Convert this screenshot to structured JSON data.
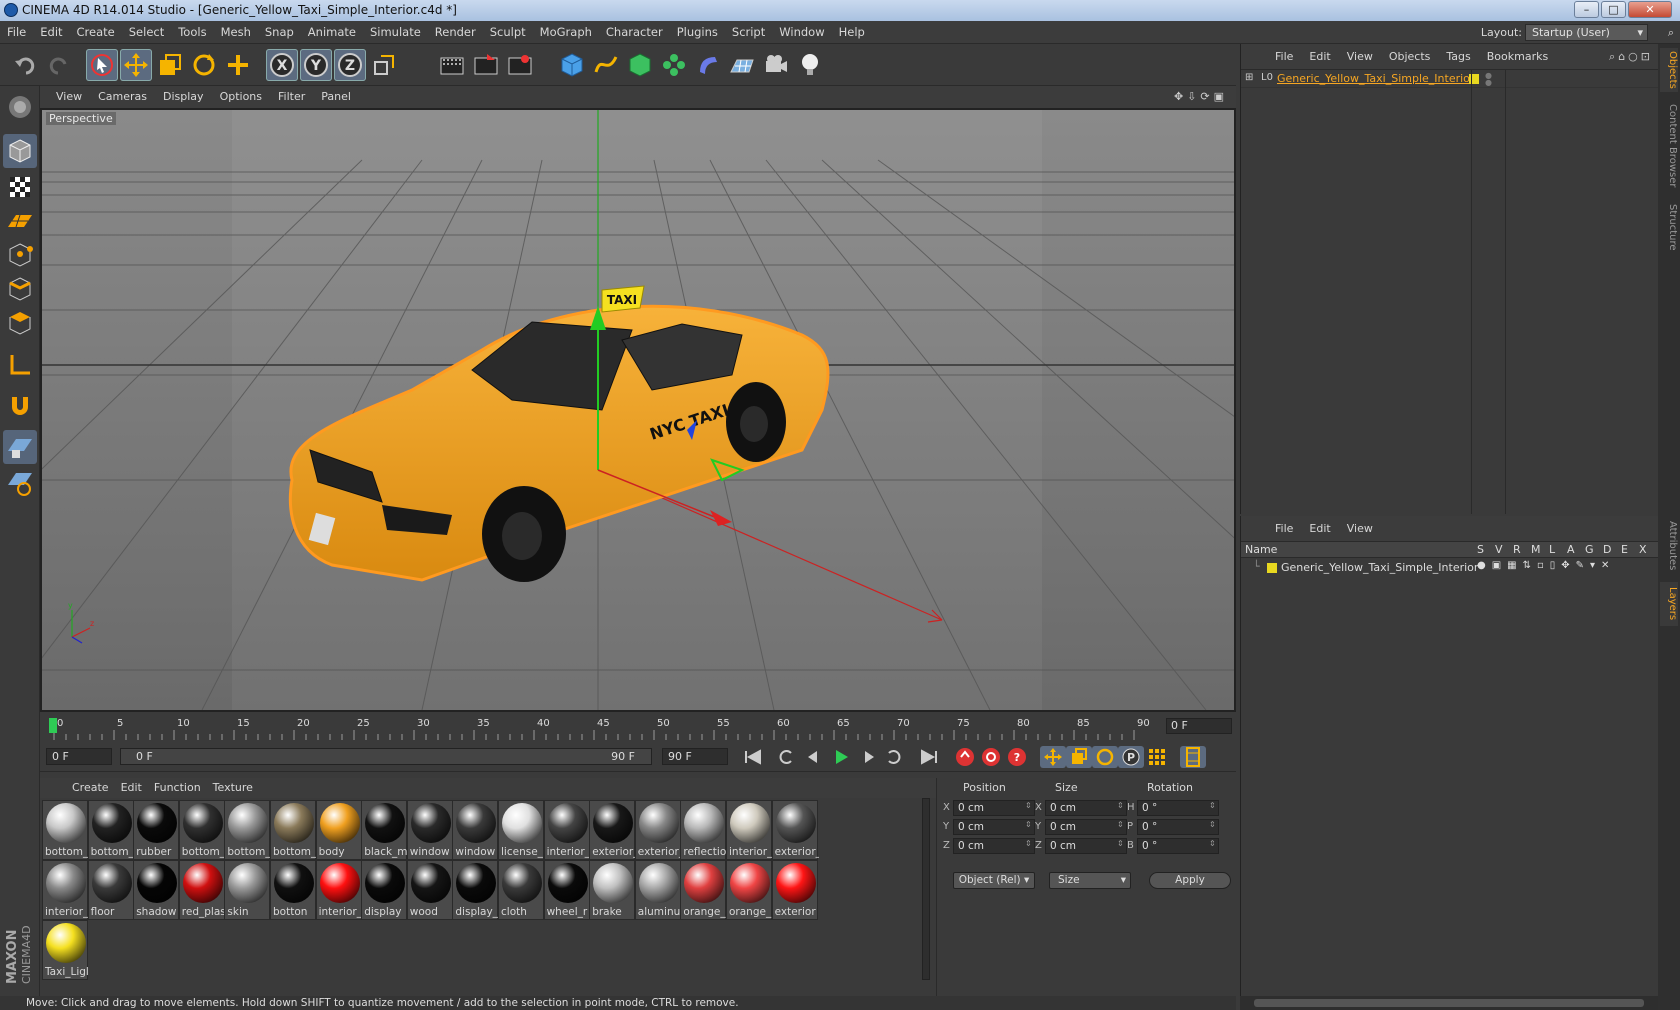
{
  "window": {
    "title": "CINEMA 4D R14.014 Studio - [Generic_Yellow_Taxi_Simple_Interior.c4d *]",
    "min": "–",
    "max": "□",
    "close": "✕"
  },
  "menu": [
    "File",
    "Edit",
    "Create",
    "Select",
    "Tools",
    "Mesh",
    "Snap",
    "Animate",
    "Simulate",
    "Render",
    "Sculpt",
    "MoGraph",
    "Character",
    "Plugins",
    "Script",
    "Window",
    "Help"
  ],
  "layout": {
    "label": "Layout:",
    "value": "Startup (User)"
  },
  "viewport": {
    "menu": [
      "View",
      "Cameras",
      "Display",
      "Options",
      "Filter",
      "Panel"
    ],
    "label": "Perspective",
    "taxi_sign": "TAXI",
    "door_text": "NYC TAXI"
  },
  "timeline": {
    "ticks": [
      "0",
      "5",
      "10",
      "15",
      "20",
      "25",
      "30",
      "35",
      "40",
      "45",
      "50",
      "55",
      "60",
      "65",
      "70",
      "75",
      "80",
      "85",
      "90"
    ],
    "current_frame": "0 F",
    "start": "0 F",
    "range_start": "0 F",
    "range_end": "90 F",
    "end": "90 F"
  },
  "materials": {
    "menu": [
      "Create",
      "Edit",
      "Function",
      "Texture"
    ],
    "items": [
      {
        "label": "bottom_",
        "color": "#c8c8c8"
      },
      {
        "label": "bottom_",
        "color": "#222222"
      },
      {
        "label": "rubber",
        "color": "#0a0a0a"
      },
      {
        "label": "bottom_",
        "color": "#303030"
      },
      {
        "label": "bottom_",
        "color": "#9a9a9a"
      },
      {
        "label": "bottom_",
        "color": "#8a7a5a"
      },
      {
        "label": "body",
        "color": "#f0a020"
      },
      {
        "label": "black_m",
        "color": "#111111"
      },
      {
        "label": "window",
        "color": "#2a2a2a"
      },
      {
        "label": "window",
        "color": "#3a3a3a"
      },
      {
        "label": "license_",
        "color": "#e0e0e0"
      },
      {
        "label": "interior_",
        "color": "#444444"
      },
      {
        "label": "exterior_",
        "color": "#181818"
      },
      {
        "label": "exterior_",
        "color": "#888888"
      },
      {
        "label": "reflectio",
        "color": "#b8b8b8"
      },
      {
        "label": "interior_",
        "color": "#cfcabd"
      },
      {
        "label": "exterior_",
        "color": "#555555"
      },
      {
        "label": "interior_",
        "color": "#8a8a8a"
      },
      {
        "label": "floor",
        "color": "#3a3a3a"
      },
      {
        "label": "shadow",
        "color": "#050505"
      },
      {
        "label": "red_plas",
        "color": "#d01010"
      },
      {
        "label": "skin",
        "color": "#9a9a9a"
      },
      {
        "label": "botton",
        "color": "#101010"
      },
      {
        "label": "interior_",
        "color": "#ff1010"
      },
      {
        "label": "display",
        "color": "#0a0a0a"
      },
      {
        "label": "wood",
        "color": "#151515"
      },
      {
        "label": "display_",
        "color": "#0a0a0a"
      },
      {
        "label": "cloth",
        "color": "#3a3a3a"
      },
      {
        "label": "wheel_r",
        "color": "#0a0a0a"
      },
      {
        "label": "brake",
        "color": "#c0c0c0"
      },
      {
        "label": "aluminu",
        "color": "#a8a8a8"
      },
      {
        "label": "orange_",
        "color": "#e04040"
      },
      {
        "label": "orange_",
        "color": "#f04545"
      },
      {
        "label": "exterior",
        "color": "#ff1515"
      },
      {
        "label": "Taxi_Ligl",
        "color": "#f5e020"
      }
    ]
  },
  "coords": {
    "headers": [
      "Position",
      "Size",
      "Rotation"
    ],
    "rows": [
      {
        "axis": "X",
        "pos": "0 cm",
        "saxis": "X",
        "size": "0 cm",
        "raxis": "H",
        "rot": "0 °"
      },
      {
        "axis": "Y",
        "pos": "0 cm",
        "saxis": "Y",
        "size": "0 cm",
        "raxis": "P",
        "rot": "0 °"
      },
      {
        "axis": "Z",
        "pos": "0 cm",
        "saxis": "Z",
        "size": "0 cm",
        "raxis": "B",
        "rot": "0 °"
      }
    ],
    "mode": "Object (Rel)",
    "size_mode": "Size",
    "apply": "Apply"
  },
  "status": "Move: Click and drag to move elements. Hold down SHIFT to quantize movement / add to the selection in point mode, CTRL to remove.",
  "objects": {
    "menu": [
      "File",
      "Edit",
      "View",
      "Objects",
      "Tags",
      "Bookmarks"
    ],
    "item": "Generic_Yellow_Taxi_Simple_Interior"
  },
  "layers": {
    "menu": [
      "File",
      "Edit",
      "View"
    ],
    "name_col": "Name",
    "cols": [
      "S",
      "V",
      "R",
      "M",
      "L",
      "A",
      "G",
      "D",
      "E",
      "X"
    ],
    "item": "Generic_Yellow_Taxi_Simple_Interior"
  },
  "sidetabs": [
    "Objects",
    "Content Browser",
    "Structure",
    "Attributes",
    "Layers"
  ]
}
